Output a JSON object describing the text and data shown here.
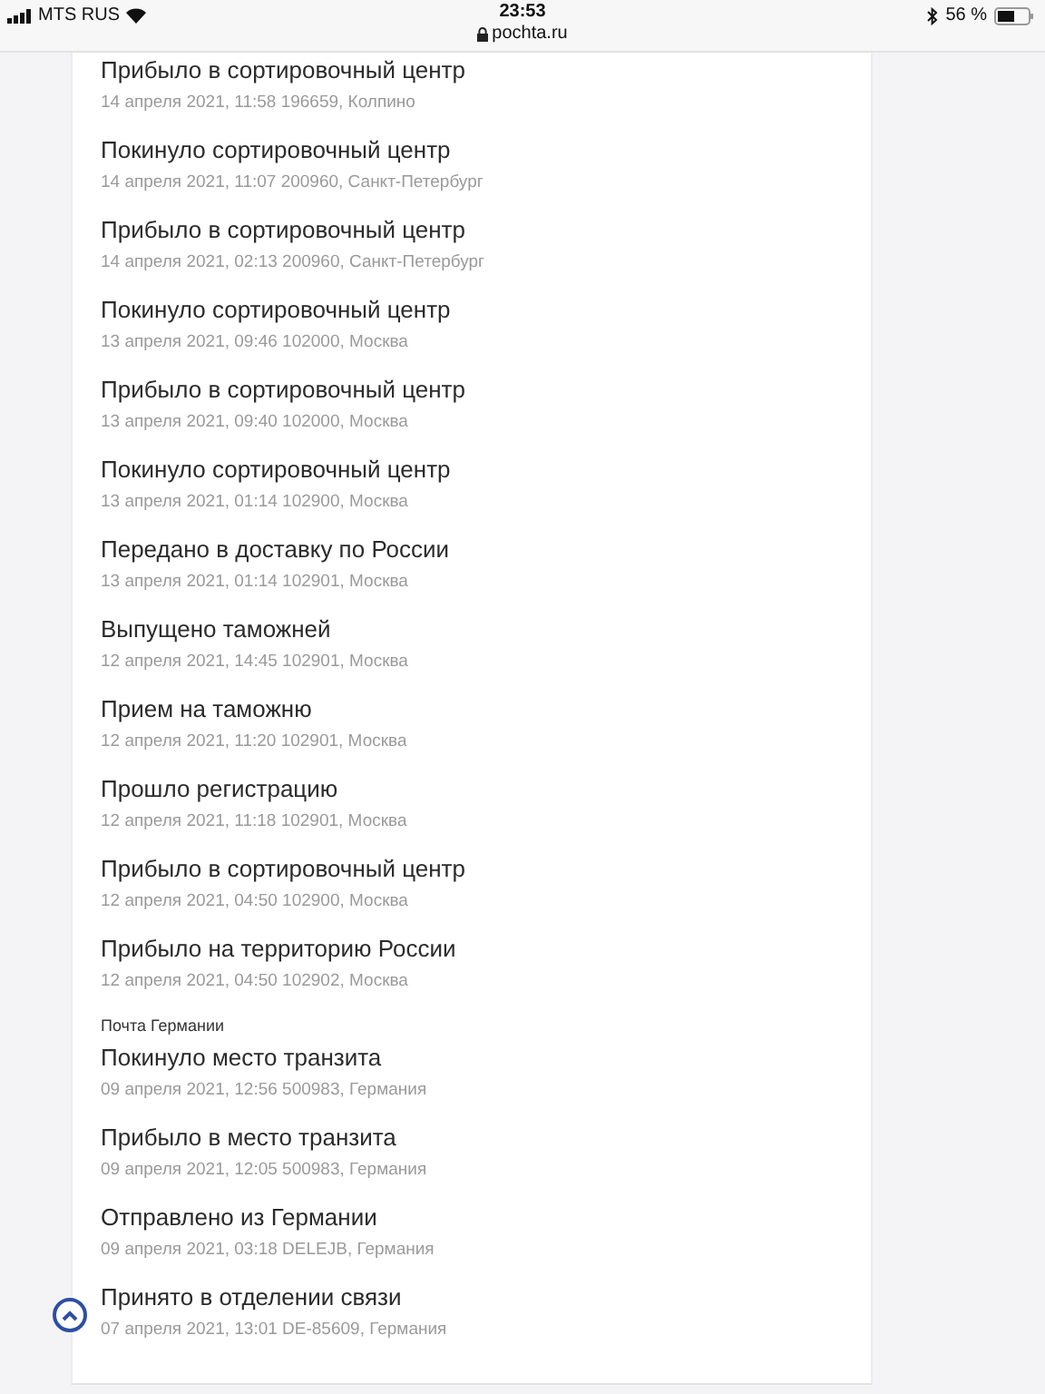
{
  "status_bar": {
    "carrier": "MTS RUS",
    "time": "23:53",
    "url": "pochta.ru",
    "battery": "56 %"
  },
  "groups": [
    {
      "events": [
        {
          "title": "Прибыло в сортировочный центр",
          "details": "14 апреля 2021, 11:58 196659, Колпино"
        },
        {
          "title": "Покинуло сортировочный центр",
          "details": "14 апреля 2021, 11:07 200960, Санкт-Петербург"
        },
        {
          "title": "Прибыло в сортировочный центр",
          "details": "14 апреля 2021, 02:13 200960, Санкт-Петербург"
        },
        {
          "title": "Покинуло сортировочный центр",
          "details": "13 апреля 2021, 09:46 102000, Москва"
        },
        {
          "title": "Прибыло в сортировочный центр",
          "details": "13 апреля 2021, 09:40 102000, Москва"
        },
        {
          "title": "Покинуло сортировочный центр",
          "details": "13 апреля 2021, 01:14 102900, Москва"
        },
        {
          "title": "Передано в доставку по России",
          "details": "13 апреля 2021, 01:14 102901, Москва"
        },
        {
          "title": "Выпущено таможней",
          "details": "12 апреля 2021, 14:45 102901, Москва"
        },
        {
          "title": "Прием на таможню",
          "details": "12 апреля 2021, 11:20 102901, Москва"
        },
        {
          "title": "Прошло регистрацию",
          "details": "12 апреля 2021, 11:18 102901, Москва"
        },
        {
          "title": "Прибыло в сортировочный центр",
          "details": "12 апреля 2021, 04:50 102900, Москва"
        },
        {
          "title": "Прибыло на территорию России",
          "details": "12 апреля 2021, 04:50 102902, Москва"
        }
      ]
    },
    {
      "label": "Почта Германии",
      "events": [
        {
          "title": "Покинуло место транзита",
          "details": "09 апреля 2021, 12:56 500983, Германия"
        },
        {
          "title": "Прибыло в место транзита",
          "details": "09 апреля 2021, 12:05 500983, Германия"
        },
        {
          "title": "Отправлено из Германии",
          "details": "09 апреля 2021, 03:18 DELEJB, Германия"
        },
        {
          "title": "Принято в отделении связи",
          "details": "07 апреля 2021, 13:01 DE-85609, Германия"
        }
      ]
    }
  ]
}
